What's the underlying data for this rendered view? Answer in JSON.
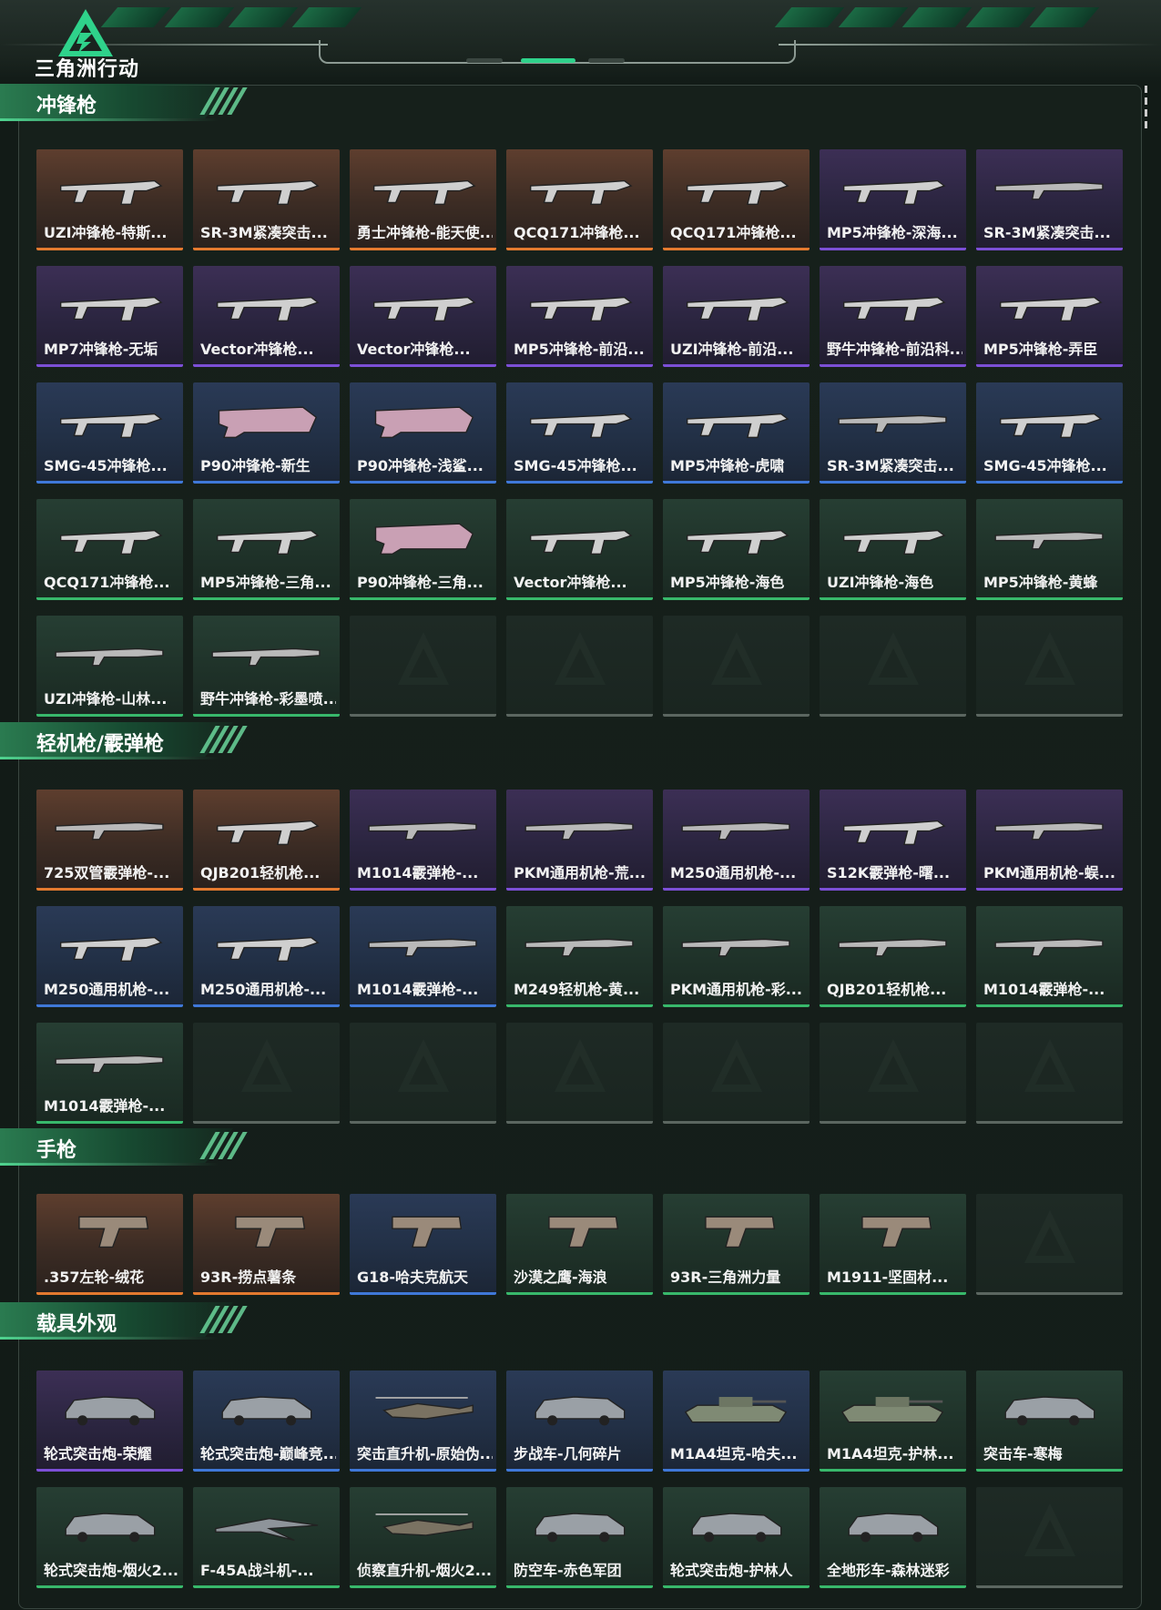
{
  "header": {
    "logo_text": "三角洲行动"
  },
  "colors": {
    "orange": "#e47a2f",
    "purple": "#7c4fd6",
    "blue": "#3f78d8",
    "green": "#38b86b",
    "accent": "#2fd28b"
  },
  "sections": [
    {
      "title": "冲锋枪",
      "items": [
        {
          "label": "UZI冲锋枪-特斯...",
          "rarity": "orange",
          "icon": "smg"
        },
        {
          "label": "SR-3M紧凑突击...",
          "rarity": "orange",
          "icon": "smg"
        },
        {
          "label": "勇士冲锋枪-能天使...",
          "rarity": "orange",
          "icon": "smg"
        },
        {
          "label": "QCQ171冲锋枪...",
          "rarity": "orange",
          "icon": "smg"
        },
        {
          "label": "QCQ171冲锋枪...",
          "rarity": "orange",
          "icon": "smg"
        },
        {
          "label": "MP5冲锋枪-深海...",
          "rarity": "purple",
          "icon": "smg"
        },
        {
          "label": "SR-3M紧凑突击...",
          "rarity": "purple",
          "icon": "rifle"
        },
        {
          "label": "MP7冲锋枪-无垢",
          "rarity": "purple",
          "icon": "smg"
        },
        {
          "label": "Vector冲锋枪...",
          "rarity": "purple",
          "icon": "smg"
        },
        {
          "label": "Vector冲锋枪...",
          "rarity": "purple",
          "icon": "smg"
        },
        {
          "label": "MP5冲锋枪-前沿...",
          "rarity": "purple",
          "icon": "smg"
        },
        {
          "label": "UZI冲锋枪-前沿...",
          "rarity": "purple",
          "icon": "smg"
        },
        {
          "label": "野牛冲锋枪-前沿科...",
          "rarity": "purple",
          "icon": "smg"
        },
        {
          "label": "MP5冲锋枪-弄臣",
          "rarity": "purple",
          "icon": "smg"
        },
        {
          "label": "SMG-45冲锋枪...",
          "rarity": "blue",
          "icon": "smg"
        },
        {
          "label": "P90冲锋枪-新生",
          "rarity": "blue",
          "icon": "p90"
        },
        {
          "label": "P90冲锋枪-浅鲨...",
          "rarity": "blue",
          "icon": "p90"
        },
        {
          "label": "SMG-45冲锋枪...",
          "rarity": "blue",
          "icon": "smg"
        },
        {
          "label": "MP5冲锋枪-虎啸",
          "rarity": "blue",
          "icon": "smg"
        },
        {
          "label": "SR-3M紧凑突击...",
          "rarity": "blue",
          "icon": "rifle"
        },
        {
          "label": "SMG-45冲锋枪...",
          "rarity": "blue",
          "icon": "smg"
        },
        {
          "label": "QCQ171冲锋枪...",
          "rarity": "green",
          "icon": "smg"
        },
        {
          "label": "MP5冲锋枪-三角...",
          "rarity": "green",
          "icon": "smg"
        },
        {
          "label": "P90冲锋枪-三角...",
          "rarity": "green",
          "icon": "p90"
        },
        {
          "label": "Vector冲锋枪...",
          "rarity": "green",
          "icon": "smg"
        },
        {
          "label": "MP5冲锋枪-海色",
          "rarity": "green",
          "icon": "smg"
        },
        {
          "label": "UZI冲锋枪-海色",
          "rarity": "green",
          "icon": "smg"
        },
        {
          "label": "MP5冲锋枪-黄蜂",
          "rarity": "green",
          "icon": "rifle"
        },
        {
          "label": "UZI冲锋枪-山林...",
          "rarity": "green",
          "icon": "rifle"
        },
        {
          "label": "野牛冲锋枪-彩墨喷...",
          "rarity": "green",
          "icon": "rifle"
        },
        {
          "label": "",
          "rarity": "empty",
          "icon": ""
        },
        {
          "label": "",
          "rarity": "empty",
          "icon": ""
        },
        {
          "label": "",
          "rarity": "empty",
          "icon": ""
        },
        {
          "label": "",
          "rarity": "empty",
          "icon": ""
        },
        {
          "label": "",
          "rarity": "empty",
          "icon": ""
        }
      ]
    },
    {
      "title": "轻机枪/霰弹枪",
      "items": [
        {
          "label": "725双管霰弹枪-...",
          "rarity": "orange",
          "icon": "rifle"
        },
        {
          "label": "QJB201轻机枪...",
          "rarity": "orange",
          "icon": "smg"
        },
        {
          "label": "M1014霰弹枪-...",
          "rarity": "purple",
          "icon": "rifle"
        },
        {
          "label": "PKM通用机枪-荒...",
          "rarity": "purple",
          "icon": "rifle"
        },
        {
          "label": "M250通用机枪-...",
          "rarity": "purple",
          "icon": "rifle"
        },
        {
          "label": "S12K霰弹枪-曙...",
          "rarity": "purple",
          "icon": "smg"
        },
        {
          "label": "PKM通用机枪-蜈...",
          "rarity": "purple",
          "icon": "rifle"
        },
        {
          "label": "M250通用机枪-...",
          "rarity": "blue",
          "icon": "smg"
        },
        {
          "label": "M250通用机枪-...",
          "rarity": "blue",
          "icon": "smg"
        },
        {
          "label": "M1014霰弹枪-...",
          "rarity": "blue",
          "icon": "rifle"
        },
        {
          "label": "M249轻机枪-黄...",
          "rarity": "green",
          "icon": "rifle"
        },
        {
          "label": "PKM通用机枪-彩...",
          "rarity": "green",
          "icon": "rifle"
        },
        {
          "label": "QJB201轻机枪...",
          "rarity": "green",
          "icon": "rifle"
        },
        {
          "label": "M1014霰弹枪-...",
          "rarity": "green",
          "icon": "rifle"
        },
        {
          "label": "M1014霰弹枪-...",
          "rarity": "green",
          "icon": "rifle"
        },
        {
          "label": "",
          "rarity": "empty",
          "icon": ""
        },
        {
          "label": "",
          "rarity": "empty",
          "icon": ""
        },
        {
          "label": "",
          "rarity": "empty",
          "icon": ""
        },
        {
          "label": "",
          "rarity": "empty",
          "icon": ""
        },
        {
          "label": "",
          "rarity": "empty",
          "icon": ""
        },
        {
          "label": "",
          "rarity": "empty",
          "icon": ""
        }
      ]
    },
    {
      "title": "手枪",
      "items": [
        {
          "label": ".357左轮-绒花",
          "rarity": "orange",
          "icon": "pistol"
        },
        {
          "label": "93R-捞点薯条",
          "rarity": "orange",
          "icon": "pistol"
        },
        {
          "label": "G18-哈夫克航天",
          "rarity": "blue",
          "icon": "pistol"
        },
        {
          "label": "沙漠之鹰-海浪",
          "rarity": "green",
          "icon": "pistol"
        },
        {
          "label": "93R-三角洲力量",
          "rarity": "green",
          "icon": "pistol"
        },
        {
          "label": "M1911-坚固材...",
          "rarity": "green",
          "icon": "pistol"
        },
        {
          "label": "",
          "rarity": "empty",
          "icon": ""
        }
      ]
    },
    {
      "title": "载具外观",
      "items": [
        {
          "label": "轮式突击炮-荣耀",
          "rarity": "purple",
          "icon": "vehicle"
        },
        {
          "label": "轮式突击炮-巅峰竞...",
          "rarity": "blue",
          "icon": "vehicle"
        },
        {
          "label": "突击直升机-原始伪...",
          "rarity": "blue",
          "icon": "heli"
        },
        {
          "label": "步战车-几何碎片",
          "rarity": "blue",
          "icon": "vehicle"
        },
        {
          "label": "M1A4坦克-哈夫...",
          "rarity": "blue",
          "icon": "tank"
        },
        {
          "label": "M1A4坦克-护林...",
          "rarity": "green",
          "icon": "tank"
        },
        {
          "label": "突击车-寒梅",
          "rarity": "green",
          "icon": "vehicle"
        },
        {
          "label": "轮式突击炮-烟火2...",
          "rarity": "green",
          "icon": "vehicle"
        },
        {
          "label": "F-45A战斗机-...",
          "rarity": "green",
          "icon": "jet"
        },
        {
          "label": "侦察直升机-烟火2...",
          "rarity": "green",
          "icon": "heli"
        },
        {
          "label": "防空车-赤色军团",
          "rarity": "green",
          "icon": "vehicle"
        },
        {
          "label": "轮式突击炮-护林人",
          "rarity": "green",
          "icon": "vehicle"
        },
        {
          "label": "全地形车-森林迷彩",
          "rarity": "green",
          "icon": "vehicle"
        },
        {
          "label": "",
          "rarity": "empty",
          "icon": ""
        }
      ]
    }
  ]
}
